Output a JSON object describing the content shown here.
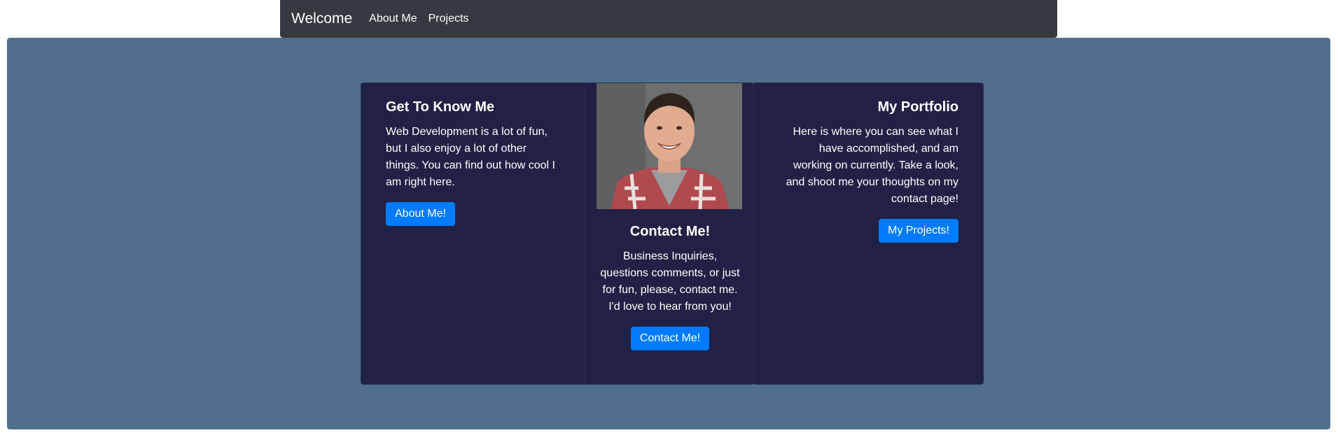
{
  "nav": {
    "brand": "Welcome",
    "links": [
      "About Me",
      "Projects"
    ]
  },
  "cards": {
    "about": {
      "title": "Get To Know Me",
      "text": "Web Development is a lot of fun, but I also enjoy a lot of other things. You can find out how cool I am right here.",
      "button": "About Me!"
    },
    "contact": {
      "title": "Contact Me!",
      "text": "Business Inquiries, questions comments, or just for fun, please, contact me. I'd love to hear from you!",
      "button": "Contact Me!"
    },
    "portfolio": {
      "title": "My Portfolio",
      "text": "Here is where you can see what I have accomplished, and am working on currently. Take a look, and shoot me your thoughts on my contact page!",
      "button": "My Projects!"
    }
  },
  "colors": {
    "navbar": "#343a40",
    "jumbotron": "#4f6f8a",
    "card": "#212145",
    "button": "#007bff"
  }
}
